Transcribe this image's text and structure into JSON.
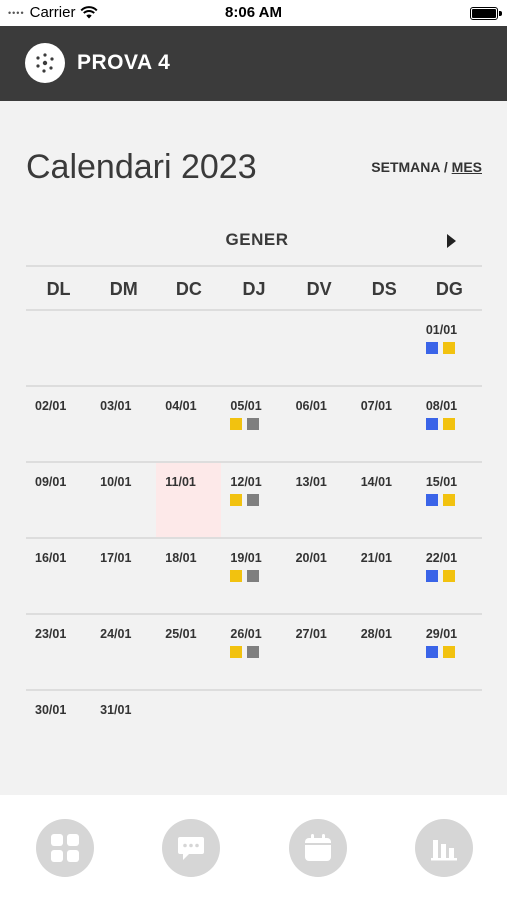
{
  "status": {
    "carrier": "Carrier",
    "time": "8:06 AM"
  },
  "header": {
    "title": "PROVA 4"
  },
  "calendar": {
    "title": "Calendari 2023",
    "view_week": "SETMANA",
    "view_sep": " / ",
    "view_month": "MES",
    "month": "GENER",
    "weekdays": [
      "DL",
      "DM",
      "DC",
      "DJ",
      "DV",
      "DS",
      "DG"
    ],
    "weeks": [
      [
        null,
        null,
        null,
        null,
        null,
        null,
        {
          "date": "01/01",
          "markers": [
            "blue",
            "yellow"
          ]
        }
      ],
      [
        {
          "date": "02/01"
        },
        {
          "date": "03/01"
        },
        {
          "date": "04/01"
        },
        {
          "date": "05/01",
          "markers": [
            "yellow",
            "gray"
          ]
        },
        {
          "date": "06/01"
        },
        {
          "date": "07/01"
        },
        {
          "date": "08/01",
          "markers": [
            "blue",
            "yellow"
          ]
        }
      ],
      [
        {
          "date": "09/01"
        },
        {
          "date": "10/01"
        },
        {
          "date": "11/01",
          "today": true
        },
        {
          "date": "12/01",
          "markers": [
            "yellow",
            "gray"
          ]
        },
        {
          "date": "13/01"
        },
        {
          "date": "14/01"
        },
        {
          "date": "15/01",
          "markers": [
            "blue",
            "yellow"
          ]
        }
      ],
      [
        {
          "date": "16/01"
        },
        {
          "date": "17/01"
        },
        {
          "date": "18/01"
        },
        {
          "date": "19/01",
          "markers": [
            "yellow",
            "gray"
          ]
        },
        {
          "date": "20/01"
        },
        {
          "date": "21/01"
        },
        {
          "date": "22/01",
          "markers": [
            "blue",
            "yellow"
          ]
        }
      ],
      [
        {
          "date": "23/01"
        },
        {
          "date": "24/01"
        },
        {
          "date": "25/01"
        },
        {
          "date": "26/01",
          "markers": [
            "yellow",
            "gray"
          ]
        },
        {
          "date": "27/01"
        },
        {
          "date": "28/01"
        },
        {
          "date": "29/01",
          "markers": [
            "blue",
            "yellow"
          ]
        }
      ],
      [
        {
          "date": "30/01"
        },
        {
          "date": "31/01"
        },
        null,
        null,
        null,
        null,
        null
      ]
    ]
  },
  "colors": {
    "header_bg": "#3b3b3b",
    "marker_blue": "#3a64e8",
    "marker_yellow": "#f2c20f",
    "marker_gray": "#7f7f7f",
    "today_bg": "#fde9e9"
  },
  "tabs": [
    {
      "icon": "grid-icon"
    },
    {
      "icon": "chat-icon"
    },
    {
      "icon": "calendar-icon"
    },
    {
      "icon": "bar-chart-icon"
    }
  ]
}
